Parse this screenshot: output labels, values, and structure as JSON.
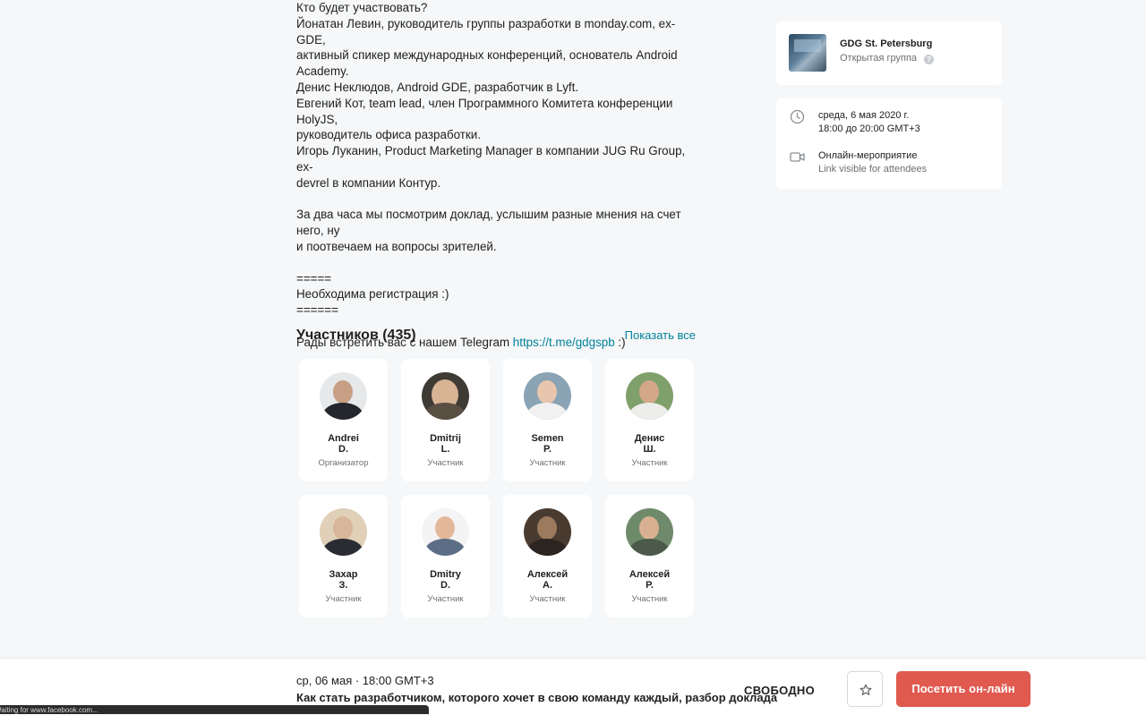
{
  "description": {
    "paragraphs": [
      "Кто будет участвовать?\nЙонатан Левин, руководитель группы разработки в monday.com, ex-GDE,\nактивный спикер международных конференций, основатель Android\nAcademy.\nДенис Неклюдов, Android GDE, разработчик в Lyft.\nЕвгений Кот, team lead, член Программного Комитета конференции HolyJS,\nруководитель офиса разработки.\nИгорь Луканин, Product Marketing Manager в компании JUG Ru Group, ex-\ndevrel в компании Контур.",
      "За два часа мы посмотрим доклад, услышим разные мнения на счет него, ну\nи поотвечаем на вопросы зрителей.",
      "=====\nНеобходима регистрация :)\n======"
    ],
    "telegram_prefix": "Рады встретить вас с нашем Telegram ",
    "telegram_link": "https://t.me/gdgspb",
    "telegram_suffix": " :)"
  },
  "members": {
    "title": "Участников (435)",
    "show_all": "Показать все",
    "list": [
      {
        "first": "Andrei",
        "last": "D.",
        "role": "Организатор"
      },
      {
        "first": "Dmitrij",
        "last": "L.",
        "role": "Участник"
      },
      {
        "first": "Semen",
        "last": "P.",
        "role": "Участник"
      },
      {
        "first": "Денис",
        "last": "Ш.",
        "role": "Участник"
      },
      {
        "first": "Захар",
        "last": "З.",
        "role": "Участник"
      },
      {
        "first": "Dmitry",
        "last": "D.",
        "role": "Участник"
      },
      {
        "first": "Алексей",
        "last": "А.",
        "role": "Участник"
      },
      {
        "first": "Алексей",
        "last": "Р.",
        "role": "Участник"
      }
    ]
  },
  "group": {
    "name": "GDG St. Petersburg",
    "type": "Открытая группа",
    "help_icon": "?"
  },
  "event": {
    "date": "среда, 6 мая 2020 г.",
    "time": "18:00 до 20:00 GMT+3",
    "location": "Онлайн-мероприятие",
    "location_note": "Link visible for attendees"
  },
  "bottom_bar": {
    "date": "ср, 06 мая · 18:00 GMT+3",
    "title": "Как стать разработчиком, которого хочет в свою команду каждый, разбор доклада",
    "price": "СВОБОДНО",
    "attend": "Посетить он-лайн"
  },
  "status_bar": "Waiting for www.facebook.com...",
  "colors": {
    "accent_link": "#00829b",
    "attend_button": "#e05a50",
    "background": "#f6f7f8"
  }
}
